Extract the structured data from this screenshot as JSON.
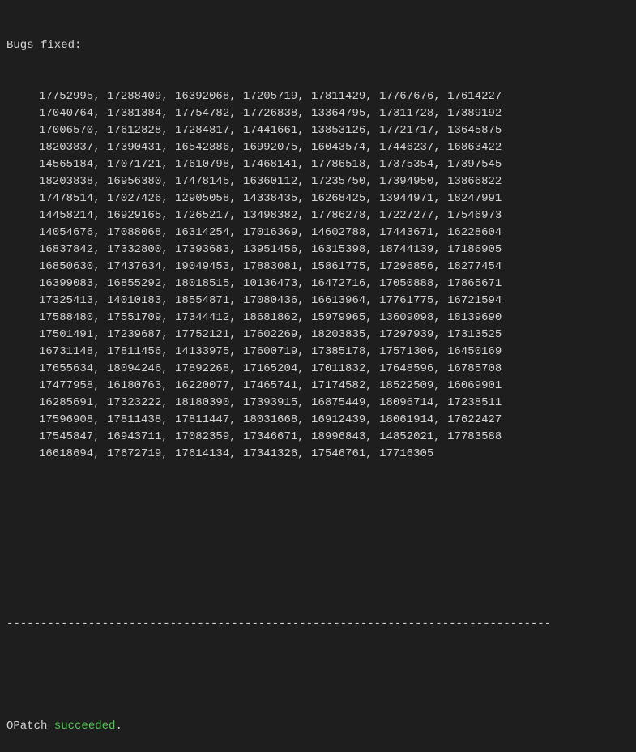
{
  "header": "Bugs fixed:",
  "bugs": [
    [
      "17752995",
      "17288409",
      "16392068",
      "17205719",
      "17811429",
      "17767676",
      "17614227"
    ],
    [
      "17040764",
      "17381384",
      "17754782",
      "17726838",
      "13364795",
      "17311728",
      "17389192"
    ],
    [
      "17006570",
      "17612828",
      "17284817",
      "17441661",
      "13853126",
      "17721717",
      "13645875"
    ],
    [
      "18203837",
      "17390431",
      "16542886",
      "16992075",
      "16043574",
      "17446237",
      "16863422"
    ],
    [
      "14565184",
      "17071721",
      "17610798",
      "17468141",
      "17786518",
      "17375354",
      "17397545"
    ],
    [
      "18203838",
      "16956380",
      "17478145",
      "16360112",
      "17235750",
      "17394950",
      "13866822"
    ],
    [
      "17478514",
      "17027426",
      "12905058",
      "14338435",
      "16268425",
      "13944971",
      "18247991"
    ],
    [
      "14458214",
      "16929165",
      "17265217",
      "13498382",
      "17786278",
      "17227277",
      "17546973"
    ],
    [
      "14054676",
      "17088068",
      "16314254",
      "17016369",
      "14602788",
      "17443671",
      "16228604"
    ],
    [
      "16837842",
      "17332800",
      "17393683",
      "13951456",
      "16315398",
      "18744139",
      "17186905"
    ],
    [
      "16850630",
      "17437634",
      "19049453",
      "17883081",
      "15861775",
      "17296856",
      "18277454"
    ],
    [
      "16399083",
      "16855292",
      "18018515",
      "10136473",
      "16472716",
      "17050888",
      "17865671"
    ],
    [
      "17325413",
      "14010183",
      "18554871",
      "17080436",
      "16613964",
      "17761775",
      "16721594"
    ],
    [
      "17588480",
      "17551709",
      "17344412",
      "18681862",
      "15979965",
      "13609098",
      "18139690"
    ],
    [
      "17501491",
      "17239687",
      "17752121",
      "17602269",
      "18203835",
      "17297939",
      "17313525"
    ],
    [
      "16731148",
      "17811456",
      "14133975",
      "17600719",
      "17385178",
      "17571306",
      "16450169"
    ],
    [
      "17655634",
      "18094246",
      "17892268",
      "17165204",
      "17011832",
      "17648596",
      "16785708"
    ],
    [
      "17477958",
      "16180763",
      "16220077",
      "17465741",
      "17174582",
      "18522509",
      "16069901"
    ],
    [
      "16285691",
      "17323222",
      "18180390",
      "17393915",
      "16875449",
      "18096714",
      "17238511"
    ],
    [
      "17596908",
      "17811438",
      "17811447",
      "18031668",
      "16912439",
      "18061914",
      "17622427"
    ],
    [
      "17545847",
      "16943711",
      "17082359",
      "17346671",
      "18996843",
      "14852021",
      "17783588"
    ],
    [
      "16618694",
      "17672719",
      "17614134",
      "17341326",
      "17546761",
      "17716305"
    ]
  ],
  "separator": "--------------------------------------------------------------------------------",
  "footer": {
    "program": "OPatch ",
    "status": "succeeded",
    "end": "."
  }
}
